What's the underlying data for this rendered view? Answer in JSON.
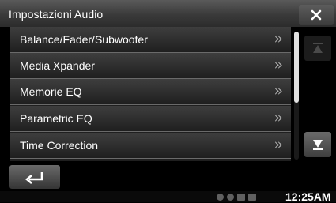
{
  "window": {
    "title": "Impostazioni Audio"
  },
  "header": {
    "close_icon": "close-x"
  },
  "menu": {
    "items": [
      {
        "label": "Balance/Fader/Subwoofer",
        "chevron": "»"
      },
      {
        "label": "Media Xpander",
        "chevron": "»"
      },
      {
        "label": "Memorie EQ",
        "chevron": "»"
      },
      {
        "label": "Parametric EQ",
        "chevron": "»"
      },
      {
        "label": "Time Correction",
        "chevron": "»"
      }
    ]
  },
  "scroll": {
    "up_icon": "scroll-up",
    "down_icon": "scroll-down",
    "position": 0.0,
    "visible_fraction": 0.55
  },
  "footer": {
    "back_icon": "return-arrow"
  },
  "status": {
    "icons": [
      "bluetooth-icon",
      "battery-icon",
      "signal-icon"
    ],
    "time": "12:25AM"
  },
  "colors": {
    "background": "#000000",
    "item_border": "#6a6a6a",
    "text": "#ffffff"
  }
}
